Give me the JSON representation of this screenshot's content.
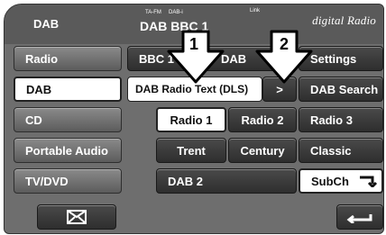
{
  "header": {
    "title": "DAB",
    "station_line": "DAB BBC 1",
    "small_ta_fm": "TA-FM",
    "small_dabi": "DAB-i",
    "small_link": "Link",
    "logo": "digital Radio"
  },
  "sources": {
    "items": [
      {
        "label": "Radio"
      },
      {
        "label": "DAB",
        "selected": true
      },
      {
        "label": "CD"
      },
      {
        "label": "Portable Audio"
      },
      {
        "label": "TV/DVD"
      }
    ],
    "message_icon": "envelope-icon"
  },
  "main": {
    "bbc_label": "BBC 1",
    "dab_label": "DAB",
    "dls_button": "DAB Radio Text (DLS)",
    "next_symbol": ">",
    "callout_1": "1",
    "callout_2": "2",
    "presets": [
      "Radio 1",
      "Radio 2",
      "Radio 3",
      "Trent",
      "Century",
      "Classic"
    ],
    "dab2": "DAB 2"
  },
  "right": {
    "settings": "Settings",
    "dab_search": "DAB Search",
    "subch": "SubCh",
    "subch_icon": "return-arrow-icon",
    "back_icon": "back-arrow-icon"
  }
}
